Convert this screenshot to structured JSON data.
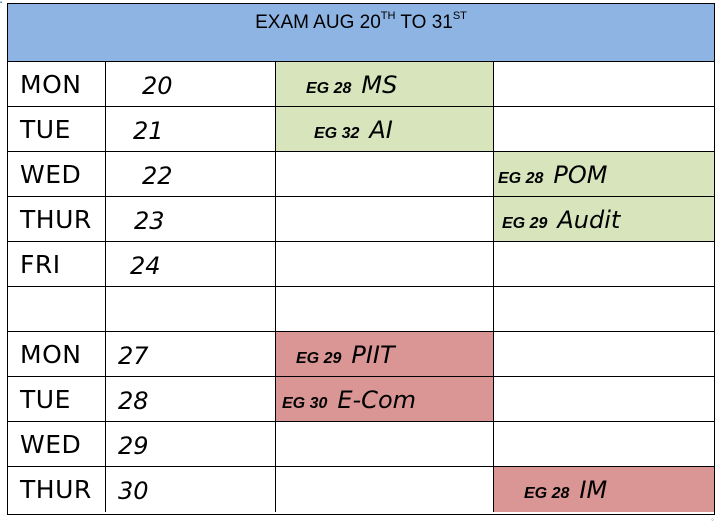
{
  "header": {
    "title_prefix": "EXAM  AUG 20",
    "sup1": "TH",
    "title_mid": " TO 31",
    "sup2": "ST"
  },
  "rows": [
    {
      "day": "MON",
      "date": "20",
      "exam_green_c3": {
        "code": "EG 28",
        "subject": "MS"
      }
    },
    {
      "day": "TUE",
      "date": "21",
      "exam_green_c3": {
        "code": "EG 32",
        "subject": "AI"
      }
    },
    {
      "day": "WED",
      "date": "22",
      "exam_green_c4": {
        "code": "EG 28",
        "subject": "POM"
      }
    },
    {
      "day": "THUR",
      "date": "23",
      "exam_green_c4": {
        "code": "EG 29",
        "subject": "Audit"
      }
    },
    {
      "day": "FRI",
      "date": "24"
    },
    {
      "day": "",
      "date": ""
    },
    {
      "day": "MON",
      "date": "27",
      "exam_red_c3": {
        "code": "EG 29",
        "subject": "PIIT"
      }
    },
    {
      "day": "TUE",
      "date": "28",
      "exam_red_c3": {
        "code": "EG 30",
        "subject": "E-Com"
      }
    },
    {
      "day": "WED",
      "date": "29"
    },
    {
      "day": "THUR",
      "date": "30",
      "exam_red_c4": {
        "code": "EG 28",
        "subject": "IM"
      }
    }
  ],
  "colors": {
    "header": "#8eb4e3",
    "green": "#d7e4bc",
    "red": "#d99694"
  }
}
